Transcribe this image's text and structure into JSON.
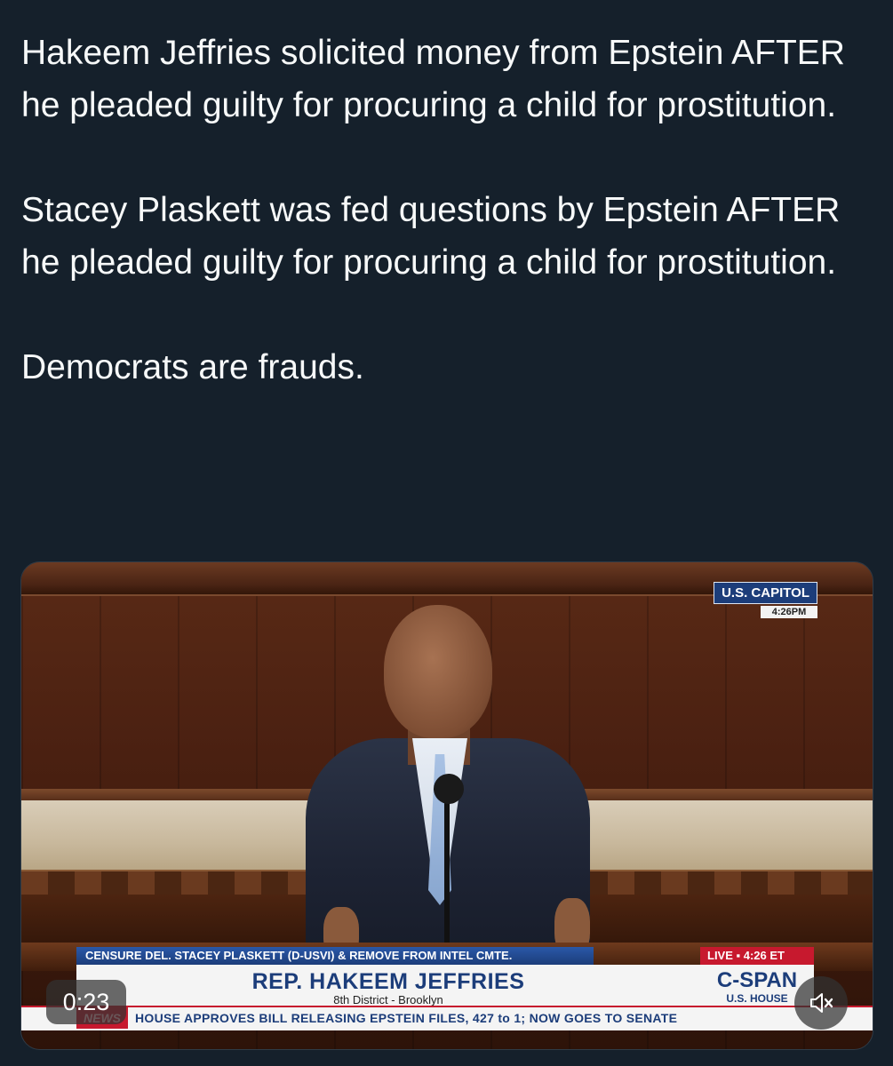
{
  "tweet": {
    "paragraph_1": "Hakeem Jeffries solicited money from Epstein AFTER he pleaded guilty for procuring a child for prostitution.",
    "paragraph_2": "Stacey Plaskett was fed questions by Epstein AFTER he pleaded guilty for procuring a child for prostitution.",
    "paragraph_3": "Democrats are frauds."
  },
  "video": {
    "location_label": "U.S. CAPITOL",
    "location_time": "4:26PM",
    "headline": "CENSURE DEL. STACEY PLASKETT (D-USVI) & REMOVE FROM INTEL CMTE.",
    "live_label": "LIVE ▪ 4:26 ET",
    "speaker_name": "REP. HAKEEM JEFFRIES",
    "speaker_district": "8th District - Brooklyn",
    "network_logo": "C-SPAN",
    "network_sub": "U.S. HOUSE",
    "ticker_label": "NEWS",
    "ticker_text": "HOUSE APPROVES BILL RELEASING EPSTEIN FILES, 427 to 1; NOW GOES TO SENATE",
    "elapsed_time": "0:23",
    "mute_icon": "speaker-muted-icon"
  },
  "colors": {
    "background": "#15202b",
    "text": "#f7f9f9",
    "cspan_blue": "#1c3d7a",
    "live_red": "#c7192e"
  }
}
